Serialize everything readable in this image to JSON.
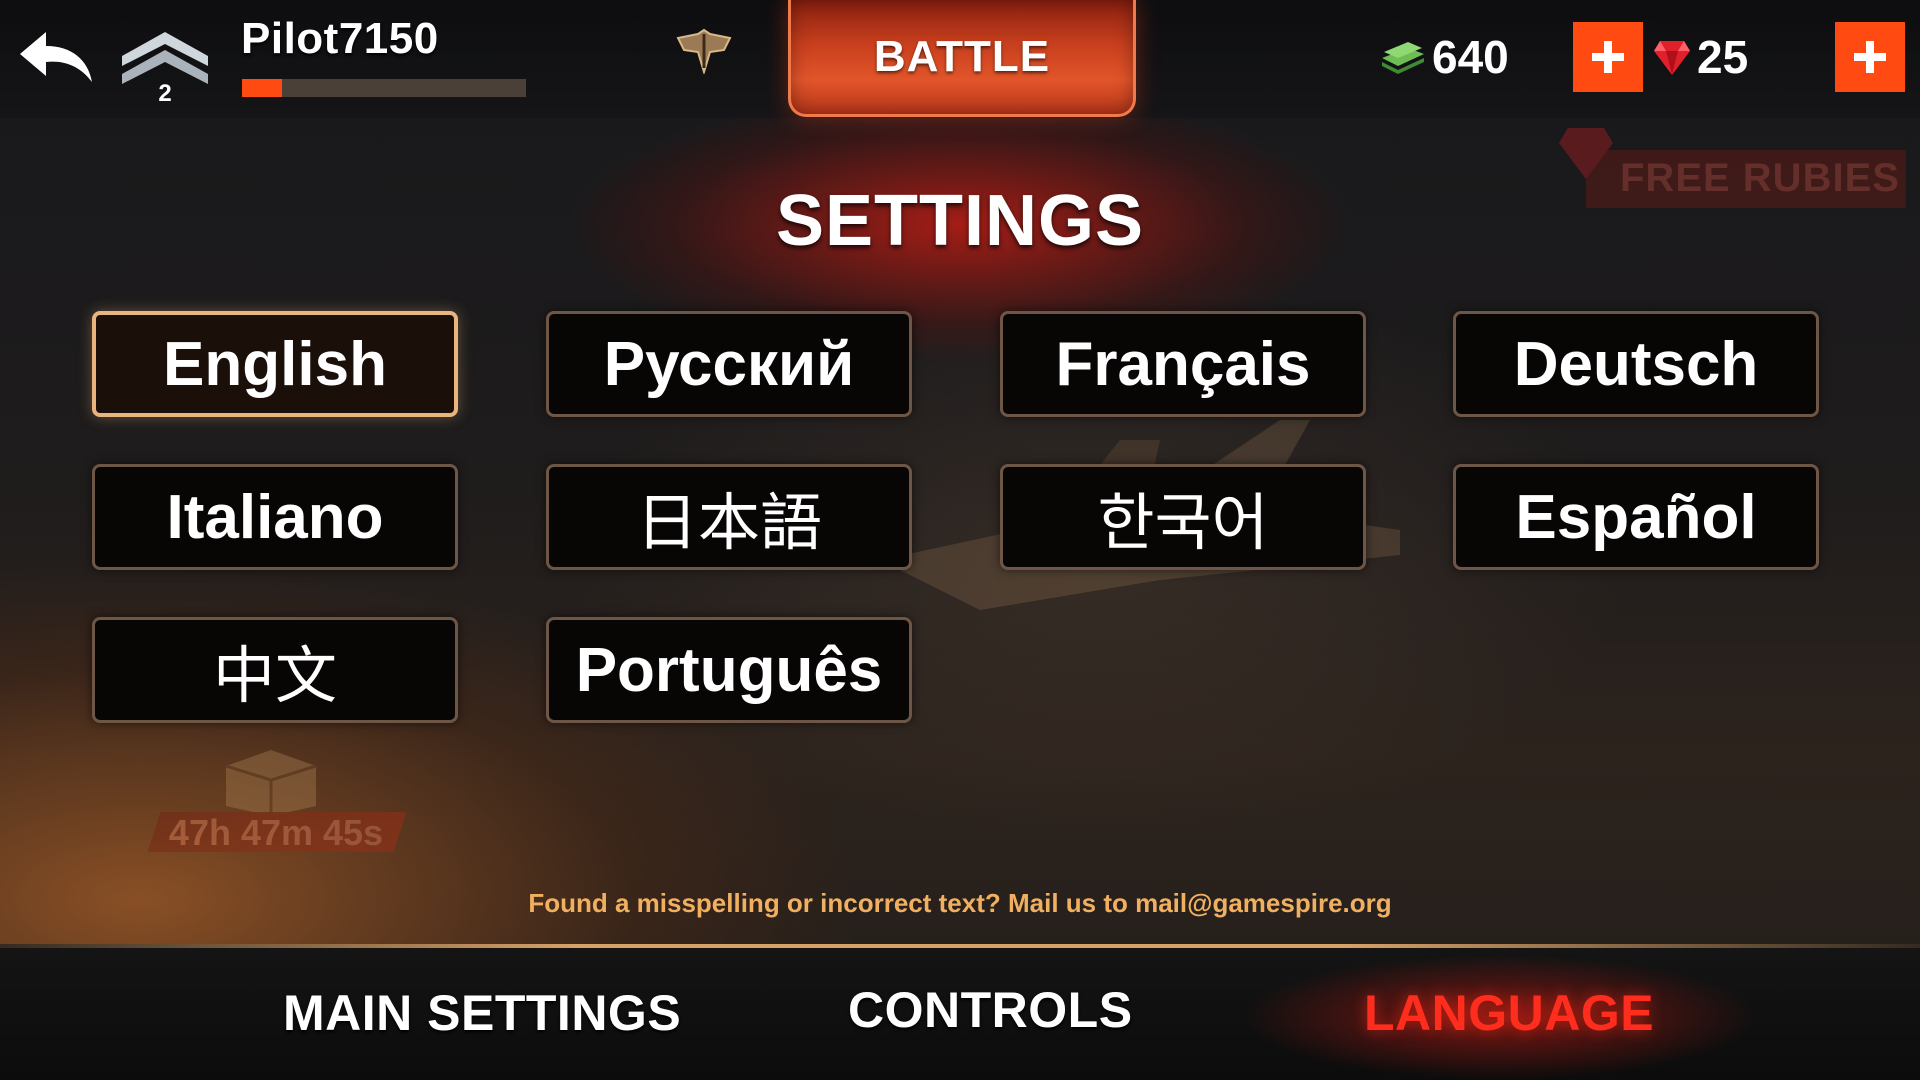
{
  "header": {
    "player_name": "Pilot7150",
    "rank_level": "2",
    "xp_progress": 0.14,
    "battle_label": "BATTLE",
    "money": "640",
    "rubies": "25",
    "free_rubies_label": "FREE RUBIES"
  },
  "title": "SETTINGS",
  "languages": [
    {
      "label": "English",
      "selected": true
    },
    {
      "label": "Русский",
      "selected": false
    },
    {
      "label": "Français",
      "selected": false
    },
    {
      "label": "Deutsch",
      "selected": false
    },
    {
      "label": "Italiano",
      "selected": false
    },
    {
      "label": "日本語",
      "selected": false
    },
    {
      "label": "한국어",
      "selected": false
    },
    {
      "label": "Español",
      "selected": false
    },
    {
      "label": "中文",
      "selected": false
    },
    {
      "label": "Português",
      "selected": false
    }
  ],
  "chest_timer": "47h 47m 45s",
  "notice": "Found a misspelling or incorrect text? Mail us to mail@gamespire.org",
  "tabs": {
    "main_settings": "MAIN SETTINGS",
    "controls": "CONTROLS",
    "language": "LANGUAGE",
    "active": "language"
  },
  "icons": {
    "back": "back-arrow-icon",
    "rank": "rank-chevron-icon",
    "emblem": "squadron-emblem-icon",
    "money": "cash-stack-icon",
    "ruby": "ruby-icon",
    "plus": "plus-icon",
    "chest": "chest-icon"
  },
  "colors": {
    "accent_orange": "#ff4a12",
    "active_tab_red": "#ff2d1e",
    "selected_border": "#e9b47e",
    "notice_text": "#f0b060"
  }
}
